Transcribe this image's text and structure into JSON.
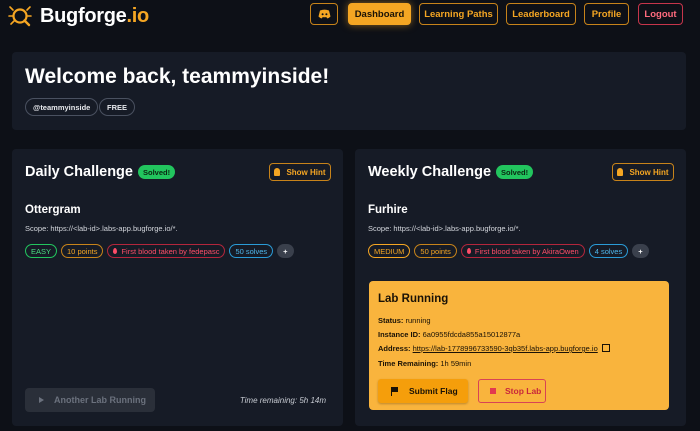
{
  "brand": {
    "name": "Bugforge",
    "suffix": ".io"
  },
  "nav": {
    "discord": "discord-icon",
    "dashboard": "Dashboard",
    "learning_paths": "Learning Paths",
    "leaderboard": "Leaderboard",
    "profile": "Profile",
    "logout": "Logout"
  },
  "welcome": {
    "title": "Welcome back, teammyinside!",
    "username": "@teammyinside",
    "plan": "FREE"
  },
  "daily": {
    "heading": "Daily Challenge",
    "badge": "Solved!",
    "hint": "Show Hint",
    "name": "Ottergram",
    "scope": "Scope: https://<lab-id>.labs-app.bugforge.io/*.",
    "tags": {
      "difficulty": "EASY",
      "points": "10 points",
      "first_blood": "First blood taken by fedepasc",
      "solves": "50 solves",
      "more": "+"
    },
    "button": "Another Lab Running",
    "time_remaining": "Time remaining: 5h 14m"
  },
  "weekly": {
    "heading": "Weekly Challenge",
    "badge": "Solved!",
    "hint": "Show Hint",
    "name": "Furhire",
    "scope": "Scope: https://<lab-id>.labs-app.bugforge.io/*.",
    "tags": {
      "difficulty": "MEDIUM",
      "points": "50 points",
      "first_blood": "First blood taken by AkiraOwen",
      "solves": "4 solves",
      "more": "+"
    },
    "lab": {
      "title": "Lab Running",
      "status_label": "Status:",
      "status_value": "running",
      "instance_label": "Instance ID:",
      "instance_value": "6a0955fdcda855a15012877a",
      "address_label": "Address:",
      "address_value": "https://lab-1778996733590-3qb35f.labs-app.bugforge.io",
      "time_label": "Time Remaining:",
      "time_value": "1h 59min",
      "submit": "Submit Flag",
      "stop": "Stop Lab"
    }
  },
  "colors": {
    "accent": "#f5a623",
    "danger": "#e23a4f",
    "success": "#22c55e",
    "background": "#0d1017",
    "card": "#161b26"
  }
}
